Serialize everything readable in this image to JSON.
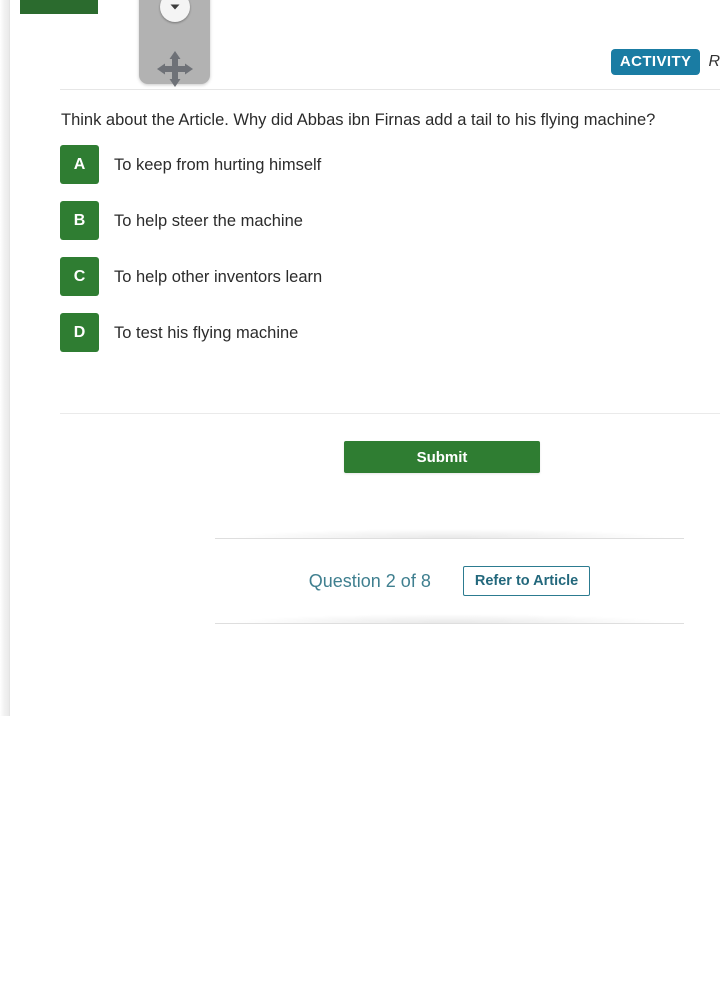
{
  "header": {
    "activity_badge": "ACTIVITY",
    "reading_label": "R",
    "progress_bar_color": "#2b6b2e",
    "badge_color": "#1a7ca3"
  },
  "drag_widget": {
    "collapse_icon": "chevron-down-icon",
    "move_icon": "move-arrows-icon"
  },
  "question": {
    "prompt": "Think about the Article. Why did Abbas ibn Firnas add a tail to his flying machine?",
    "options": [
      {
        "letter": "A",
        "text": "To keep from hurting himself"
      },
      {
        "letter": "B",
        "text": "To help steer the machine"
      },
      {
        "letter": "C",
        "text": "To help other inventors learn"
      },
      {
        "letter": "D",
        "text": "To test his flying machine"
      }
    ],
    "option_color": "#2f7d32"
  },
  "actions": {
    "submit_label": "Submit",
    "submit_color": "#2f7d32"
  },
  "footer": {
    "counter": "Question 2 of 8",
    "refer_label": "Refer to Article",
    "accent_color": "#2c7b90"
  }
}
